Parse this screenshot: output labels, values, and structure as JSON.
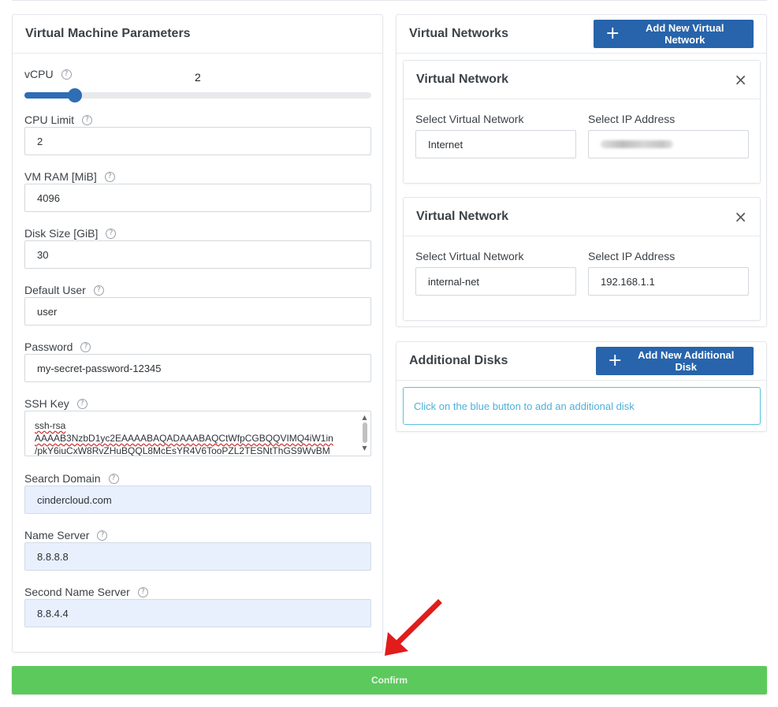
{
  "vm_params": {
    "title": "Virtual Machine Parameters",
    "help_glyph": "?",
    "vcpu": {
      "label": "vCPU",
      "value": "2",
      "fraction": 0.08
    },
    "cpu_limit": {
      "label": "CPU Limit",
      "value": "2"
    },
    "ram": {
      "label": "VM RAM [MiB]",
      "value": "4096"
    },
    "disk": {
      "label": "Disk Size [GiB]",
      "value": "30"
    },
    "default_user": {
      "label": "Default User",
      "value": "user"
    },
    "password": {
      "label": "Password",
      "value": "my-secret-password-12345"
    },
    "ssh_key": {
      "label": "SSH Key",
      "line1": "ssh-rsa",
      "line2": "AAAAB3NzbD1yc2EAAAABAQADAAABAQCtWfpCGBQQVIMQ4iW1in",
      "line3": "/pkY6iuCxW8RvZHuBQQL8McEsYR4V6TooPZL2TESNtThGS9WvBM"
    },
    "search_domain": {
      "label": "Search Domain",
      "value": "cindercloud.com"
    },
    "name_server": {
      "label": "Name Server",
      "value": "8.8.8.8"
    },
    "second_name_server": {
      "label": "Second Name Server",
      "value": "8.8.4.4"
    }
  },
  "virtual_networks": {
    "title": "Virtual Networks",
    "add_button": {
      "icon": "+",
      "label": "Add New Virtual Network"
    },
    "items": [
      {
        "title": "Virtual Network",
        "close": "×",
        "network_label": "Select Virtual Network",
        "network_value": "Internet",
        "ip_label": "Select IP Address",
        "ip_value": ""
      },
      {
        "title": "Virtual Network",
        "close": "×",
        "network_label": "Select Virtual Network",
        "network_value": "internal-net",
        "ip_label": "Select IP Address",
        "ip_value": "192.168.1.1"
      }
    ]
  },
  "additional_disks": {
    "title": "Additional Disks",
    "add_button": {
      "icon": "+",
      "label": "Add New Additional Disk"
    },
    "info": "Click on the blue button to add an additional disk"
  },
  "confirm_label": "Confirm",
  "colors": {
    "primary": "#2764ab",
    "confirm": "#5cc95c",
    "info": "#5bc0de",
    "annotation_arrow": "#e21b1b"
  }
}
